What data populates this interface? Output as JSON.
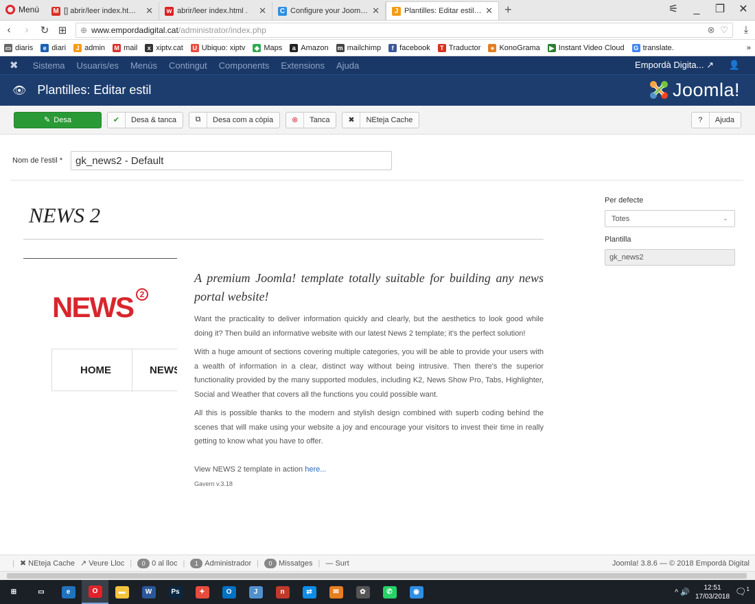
{
  "browser": {
    "menu_label": "Menú",
    "tabs": [
      {
        "title": "[] abrir/leer index.html . (Jo",
        "icon": "gmail-icon",
        "color": "#d93025",
        "glyph": "M"
      },
      {
        "title": "abrir/leer index.html .",
        "icon": "webmail-icon",
        "color": "#e02020",
        "glyph": "w"
      },
      {
        "title": "Configure your Joomla we",
        "icon": "page-icon",
        "color": "#2d8ee3",
        "glyph": "C"
      },
      {
        "title": "Plantilles: Editar estil - Emp",
        "icon": "joomla-icon",
        "color": "#f39c12",
        "glyph": "J",
        "active": true
      }
    ],
    "new_tab": "+",
    "window_controls": [
      "⚟",
      "_",
      "❐",
      "✕"
    ],
    "url_host": "www.empordadigital.cat",
    "url_path": "/administrator/index.php",
    "bookmarks": [
      {
        "label": "diaris",
        "icon": "folder-icon",
        "color": "#666",
        "glyph": "▭"
      },
      {
        "label": "diari",
        "icon": "diari-icon",
        "color": "#1a5fb4",
        "glyph": "e"
      },
      {
        "label": "admin",
        "icon": "joomla-icon",
        "color": "#f39c12",
        "glyph": "J"
      },
      {
        "label": "mail",
        "icon": "gmail-icon",
        "color": "#d93025",
        "glyph": "M"
      },
      {
        "label": "xiptv.cat",
        "icon": "xiptv-icon",
        "color": "#333",
        "glyph": "x"
      },
      {
        "label": "Ubiquo: xiptv",
        "icon": "ubiquo-icon",
        "color": "#e74c3c",
        "glyph": "U"
      },
      {
        "label": "Maps",
        "icon": "maps-icon",
        "color": "#34a853",
        "glyph": "◆"
      },
      {
        "label": "Amazon",
        "icon": "amazon-icon",
        "color": "#222",
        "glyph": "a"
      },
      {
        "label": "mailchimp",
        "icon": "mailchimp-icon",
        "color": "#444",
        "glyph": "m"
      },
      {
        "label": "facebook",
        "icon": "facebook-icon",
        "color": "#3b5998",
        "glyph": "f"
      },
      {
        "label": "Traductor",
        "icon": "translator-icon",
        "color": "#d93025",
        "glyph": "T"
      },
      {
        "label": "KonoGrama",
        "icon": "konograma-icon",
        "color": "#e67e22",
        "glyph": "●"
      },
      {
        "label": "Instant Video Cloud",
        "icon": "video-icon",
        "color": "#2e7d32",
        "glyph": "▶"
      },
      {
        "label": "translate.",
        "icon": "translate-icon",
        "color": "#4285f4",
        "glyph": "G"
      }
    ],
    "bookmarks_more": "»"
  },
  "joomla_menu": {
    "items": [
      "Sistema",
      "Usuaris/es",
      "Menús",
      "Contingut",
      "Components",
      "Extensions",
      "Ajuda"
    ],
    "site_name": "Empordà Digita...",
    "site_icon": "↗",
    "user_icon": "👤"
  },
  "page_title": "Plantilles: Editar estil",
  "brand_text": "Joomla!",
  "toolbar": {
    "save": "Desa",
    "save_close": "Desa & tanca",
    "save_copy": "Desa com a còpia",
    "close": "Tanca",
    "clear_cache": "NEteja Cache",
    "help": "Ajuda"
  },
  "style_name": {
    "label": "Nom de l'estil *",
    "value": "gk_news2 - Default"
  },
  "template": {
    "name": "NEWS 2",
    "thumb_logo": "NEWS",
    "thumb_sup": "2",
    "thumb_nav": [
      "HOME",
      "NEWS"
    ],
    "tagline": "A premium Joomla! template totally suitable for building any news portal website!",
    "paragraphs": [
      "Want the practicality to deliver information quickly and clearly, but the aesthetics to look good while doing it? Then build an informative website with our latest News 2 template; it's the perfect solution!",
      "With a huge amount of sections covering multiple categories, you will be able to provide your users with a wealth of information in a clear, distinct way without being intrusive. Then there's the superior functionality provided by the many supported modules, including K2, News Show Pro, Tabs, Highlighter, Social and Weather that covers all the functions you could possible want.",
      "All this is possible thanks to the modern and stylish design combined with superb coding behind the scenes that will make using your website a joy and encourage your visitors to invest their time in really getting to know what you have to offer."
    ],
    "view_text": "View NEWS 2 template in action ",
    "view_link": "here...",
    "version": "Gavern v.3.18"
  },
  "params": {
    "default_label": "Per defecte",
    "default_value": "Totes",
    "template_label": "Plantilla",
    "template_value": "gk_news2"
  },
  "status": {
    "cache": "NEteja Cache",
    "view_site": "Veure Lloc",
    "online_count": "0",
    "online_label": "0 al lloc",
    "admin_count": "1",
    "admin_label": "Administrador",
    "msg_count": "0",
    "msg_label": "Missatges",
    "logout": "Surt",
    "copyright": "Joomla! 3.8.6 — © 2018 Empordà Digital"
  },
  "taskbar": {
    "apps": [
      {
        "name": "start-button",
        "color": "#1b1f26",
        "glyph": "⊞"
      },
      {
        "name": "task-view-icon",
        "color": "#1b1f26",
        "glyph": "▭"
      },
      {
        "name": "edge-icon",
        "color": "#1e73be",
        "glyph": "e"
      },
      {
        "name": "opera-icon",
        "color": "#e0222b",
        "glyph": "O",
        "active": true
      },
      {
        "name": "explorer-icon",
        "color": "#f5c43c",
        "glyph": "▬"
      },
      {
        "name": "word-icon",
        "color": "#2b579a",
        "glyph": "W"
      },
      {
        "name": "photoshop-icon",
        "color": "#0b2740",
        "glyph": "Ps"
      },
      {
        "name": "app-red-icon",
        "color": "#e74c3c",
        "glyph": "✦"
      },
      {
        "name": "outlook-icon",
        "color": "#0072c6",
        "glyph": "O"
      },
      {
        "name": "joomla-app-icon",
        "color": "#5091cd",
        "glyph": "J"
      },
      {
        "name": "nero-icon",
        "color": "#c0392b",
        "glyph": "n"
      },
      {
        "name": "teamviewer-icon",
        "color": "#0e8ee9",
        "glyph": "⇄"
      },
      {
        "name": "mail-app-icon",
        "color": "#e67e22",
        "glyph": "✉"
      },
      {
        "name": "media-icon",
        "color": "#555",
        "glyph": "✿"
      },
      {
        "name": "whatsapp-icon",
        "color": "#25d366",
        "glyph": "✆"
      },
      {
        "name": "camera-icon",
        "color": "#2d8ee3",
        "glyph": "◉"
      }
    ],
    "time": "12:51",
    "date": "17/03/2018",
    "tray_icons": "^ 🔊",
    "notif": "1"
  }
}
